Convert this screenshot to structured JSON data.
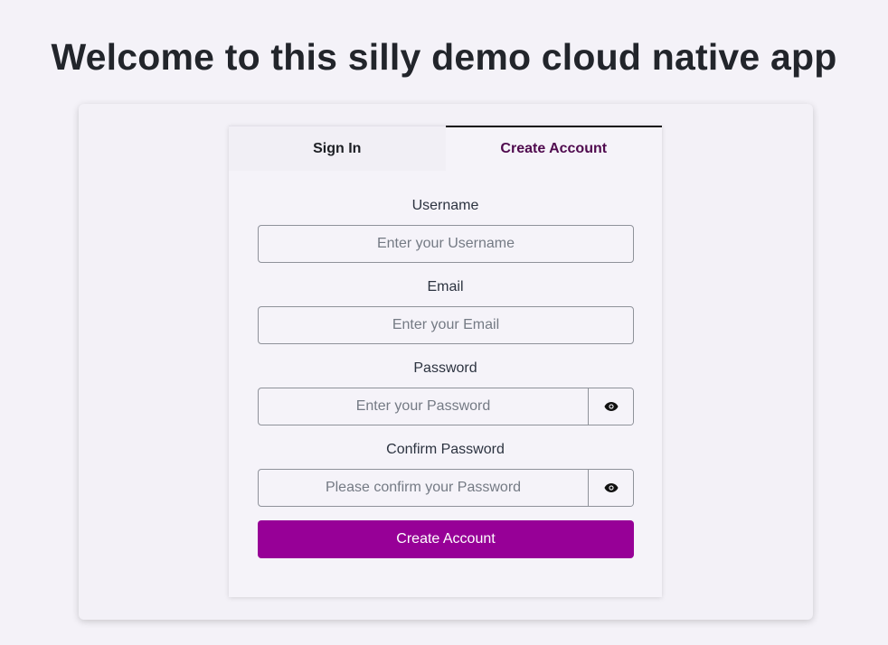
{
  "page": {
    "title": "Welcome to this silly demo cloud native app"
  },
  "tabs": [
    {
      "label": "Sign In",
      "active": false
    },
    {
      "label": "Create Account",
      "active": true
    }
  ],
  "form": {
    "username": {
      "label": "Username",
      "placeholder": "Enter your Username",
      "value": ""
    },
    "email": {
      "label": "Email",
      "placeholder": "Enter your Email",
      "value": ""
    },
    "password": {
      "label": "Password",
      "placeholder": "Enter your Password",
      "value": "",
      "toggle_icon": "eye-icon"
    },
    "confirm_password": {
      "label": "Confirm Password",
      "placeholder": "Please confirm your Password",
      "value": "",
      "toggle_icon": "eye-icon"
    },
    "submit_label": "Create Account"
  },
  "colors": {
    "accent": "#970097",
    "active_tab_text": "#4f0a4e",
    "background": "#f4f2f8"
  }
}
